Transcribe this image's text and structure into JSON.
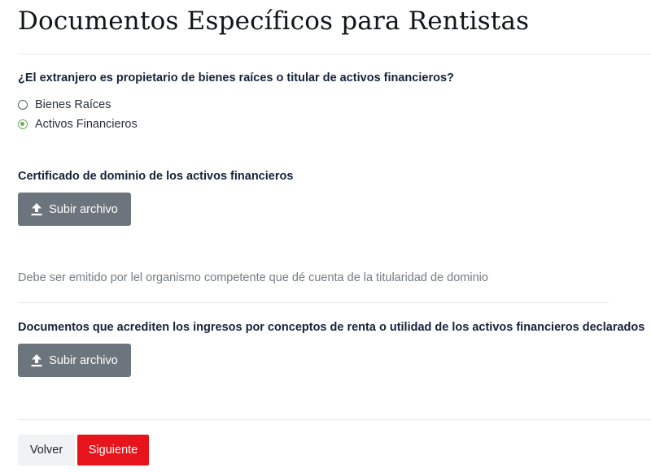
{
  "page": {
    "title": "Documentos Específicos para Rentistas"
  },
  "question": {
    "text": "¿El extranjero es propietario de bienes raíces o titular de activos financieros?",
    "options": [
      {
        "label": "Bienes Raíces",
        "checked": false
      },
      {
        "label": "Activos Financieros",
        "checked": true
      }
    ]
  },
  "fields": [
    {
      "label": "Certificado de dominio de los activos financieros",
      "button_label": "Subir archivo",
      "help_text": "Debe ser emitido por lel organismo competente que dé cuenta de la titularidad de dominio"
    },
    {
      "label": "Documentos que acrediten los ingresos por conceptos de renta o utilidad de los activos financieros declarados",
      "button_label": "Subir archivo"
    }
  ],
  "footer": {
    "back_label": "Volver",
    "next_label": "Siguiente"
  },
  "colors": {
    "upload_button": "#6c757d",
    "next_button": "#e8141c",
    "radio_checked": "#6fa95b"
  },
  "icons": {
    "upload": "upload-arrow-icon"
  }
}
